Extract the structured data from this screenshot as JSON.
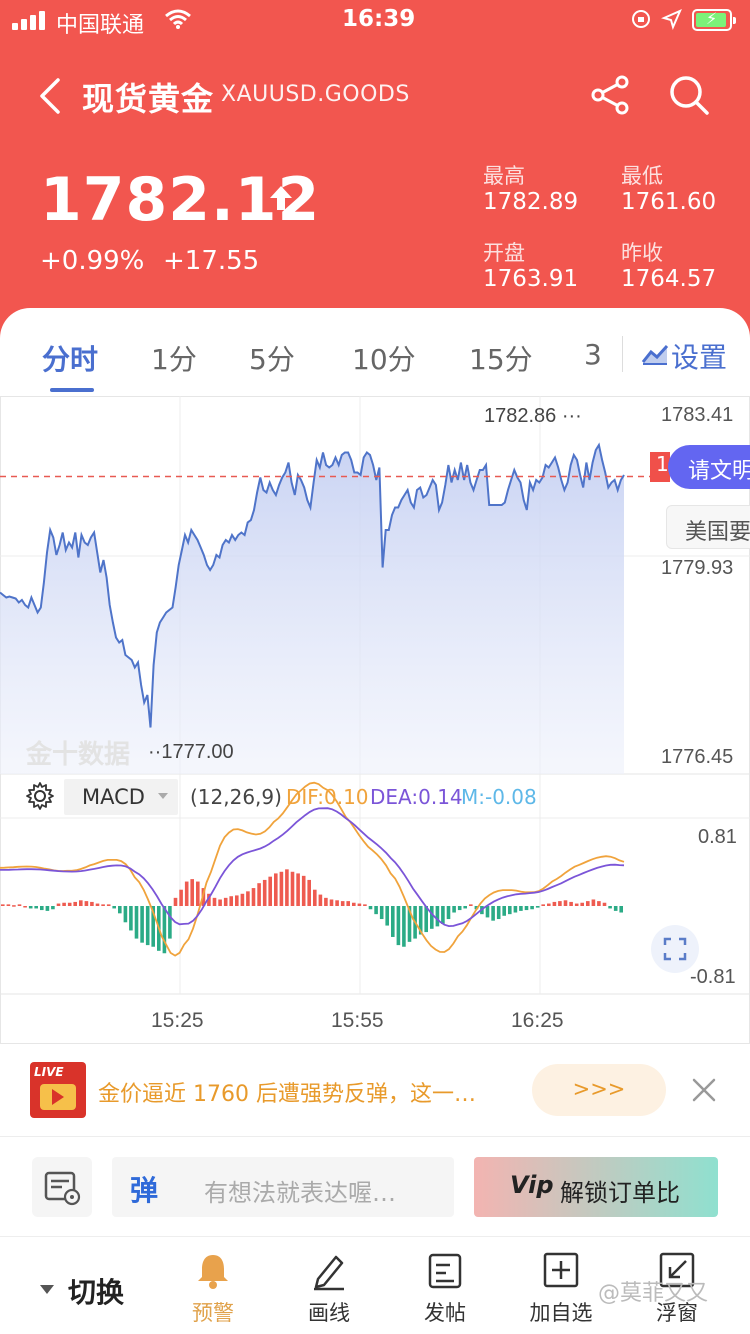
{
  "status_bar": {
    "carrier": "中国联通",
    "time": "16:39"
  },
  "header": {
    "title": "现货黄金",
    "symbol": "XAUUSD.GOODS"
  },
  "quote": {
    "price": "1782.12",
    "change_percent": "+0.99%",
    "change_value": "+17.55",
    "stats": [
      {
        "label": "最高",
        "value": "1782.89"
      },
      {
        "label": "最低",
        "value": "1761.60"
      },
      {
        "label": "开盘",
        "value": "1763.91"
      },
      {
        "label": "昨收",
        "value": "1764.57"
      }
    ]
  },
  "tabs": [
    {
      "label": "分时",
      "active": true
    },
    {
      "label": "1分"
    },
    {
      "label": "5分"
    },
    {
      "label": "10分"
    },
    {
      "label": "15分"
    },
    {
      "label": "3"
    }
  ],
  "settings_label": "设置",
  "chart_data": {
    "type": "area",
    "ylim": [
      1776.45,
      1783.41
    ],
    "yticks": [
      "1783.41",
      "1779.93",
      "1776.45"
    ],
    "xticks": [
      "15:25",
      "15:55",
      "16:25"
    ],
    "reference_line": 1782.12,
    "high_marker": "1782.86",
    "low_marker": "1777.00",
    "price_series": [
      1779.8,
      1779.75,
      1779.7,
      1779.72,
      1779.7,
      1779.68,
      1779.6,
      1779.65,
      1779.55,
      1779.5,
      1779.7,
      1779.55,
      1779.4,
      1779.5,
      1780.0,
      1780.6,
      1781.05,
      1780.9,
      1780.55,
      1780.75,
      1781.0,
      1780.65,
      1780.8,
      1780.7,
      1781.0,
      1780.5,
      1780.95,
      1780.8,
      1780.75,
      1780.9,
      1781.0,
      1780.6,
      1780.2,
      1780.45,
      1780.1,
      1779.55,
      1779.2,
      1778.9,
      1778.8,
      1778.85,
      1778.55,
      1778.5,
      1778.45,
      1778.3,
      1778.4,
      1777.95,
      1777.6,
      1777.75,
      1777.1,
      1778.35,
      1779.0,
      1779.2,
      1779.3,
      1779.4,
      1779.45,
      1779.5,
      1779.9,
      1780.35,
      1780.65,
      1780.95,
      1780.8,
      1781.05,
      1780.95,
      1780.85,
      1780.7,
      1780.55,
      1780.35,
      1780.25,
      1780.35,
      1780.55,
      1780.5,
      1780.75,
      1780.85,
      1780.8,
      1780.95,
      1780.85,
      1780.95,
      1781.0,
      1780.95,
      1781.2,
      1781.25,
      1781.45,
      1781.8,
      1782.1,
      1781.85,
      1781.8,
      1782.0,
      1781.85,
      1781.75,
      1781.95,
      1782.1,
      1782.2,
      1782.4,
      1782.0,
      1781.75,
      1782.15,
      1782.05,
      1781.9,
      1781.65,
      1781.5,
      1782.0,
      1782.45,
      1782.3,
      1782.6,
      1782.35,
      1782.3,
      1782.35,
      1782.5,
      1782.35,
      1782.55,
      1782.6,
      1782.6,
      1782.45,
      1782.2,
      1782.2,
      1782.15,
      1782.5,
      1782.6,
      1782.55,
      1782.35,
      1782.05,
      1782.3,
      1780.3,
      1781.05,
      1781.05,
      1781.35,
      1781.5,
      1781.5,
      1781.65,
      1781.75,
      1781.85,
      1781.6,
      1781.5,
      1781.85,
      1781.9,
      1781.7,
      1781.75,
      1781.9,
      1782.05,
      1781.95,
      1781.45,
      1781.6,
      1781.95,
      1782.35,
      1782.0,
      1782.25,
      1782.05,
      1782.4,
      1782.05,
      1782.35,
      1782.0,
      1781.85,
      1782.05,
      1782.25,
      1782.25,
      1782.35,
      1781.55,
      1781.55,
      1781.55,
      1781.55,
      1781.55,
      1781.6,
      1781.85,
      1782.05,
      1782.25,
      1782.1,
      1782.0,
      1781.65,
      1781.45,
      1782.0,
      1781.85,
      1782.05,
      1782.0,
      1782.1,
      1782.35,
      1782.3,
      1782.4,
      1782.5,
      1782.3,
      1782.05,
      1781.85,
      1782.0,
      1782.35,
      1782.55,
      1782.45,
      1782.15,
      1781.9,
      1782.4,
      1782.05,
      1782.4,
      1782.65,
      1782.75,
      1782.45,
      1782.2,
      1781.9,
      1782.0,
      1782.05,
      1781.85,
      1782.05,
      1782.15
    ],
    "macd_label": "MACD",
    "macd_params": "(12,26,9)",
    "dif": "DIF:0.10",
    "dea": "DEA:0.14",
    "m": "M:-0.08",
    "macd_ylim": [
      -0.81,
      0.81
    ],
    "macd_yticks": [
      "0.81",
      "-0.81"
    ],
    "macd_hist": [
      0.02,
      0.02,
      0.01,
      0.02,
      0.0,
      -0.03,
      -0.03,
      -0.05,
      -0.06,
      -0.04,
      0.03,
      0.04,
      0.04,
      0.05,
      0.07,
      0.06,
      0.05,
      0.03,
      0.02,
      0.02,
      -0.03,
      -0.09,
      -0.2,
      -0.3,
      -0.4,
      -0.45,
      -0.48,
      -0.5,
      -0.55,
      -0.58,
      -0.4,
      0.1,
      0.2,
      0.3,
      0.33,
      0.3,
      0.22,
      0.15,
      0.1,
      0.08,
      0.1,
      0.12,
      0.13,
      0.15,
      0.18,
      0.22,
      0.28,
      0.32,
      0.36,
      0.4,
      0.42,
      0.45,
      0.42,
      0.4,
      0.37,
      0.32,
      0.2,
      0.14,
      0.1,
      0.08,
      0.07,
      0.06,
      0.06,
      0.04,
      0.03,
      0.02,
      -0.04,
      -0.1,
      -0.16,
      -0.24,
      -0.38,
      -0.48,
      -0.5,
      -0.44,
      -0.4,
      -0.35,
      -0.32,
      -0.28,
      -0.25,
      -0.22,
      -0.16,
      -0.08,
      -0.05,
      -0.03,
      0.02,
      -0.04,
      -0.1,
      -0.14,
      -0.18,
      -0.16,
      -0.12,
      -0.1,
      -0.08,
      -0.06,
      -0.05,
      -0.04,
      -0.02,
      0.02,
      0.03,
      0.05,
      0.06,
      0.07,
      0.05,
      0.03,
      0.04,
      0.06,
      0.08,
      0.06,
      0.04,
      -0.03,
      -0.06,
      -0.08
    ]
  },
  "buttons": {
    "read_news": "请文明",
    "us_data": "美国要"
  },
  "watermark": "金十数据",
  "news_banner": {
    "live": "LIVE",
    "text": "金价逼近 1760 后遭强势反弹，这一…",
    "more": ">>>"
  },
  "comment_bar": {
    "dan_icon": "弹",
    "placeholder": "有想法就表达喔…",
    "vip": "Vip",
    "vip_text": "解锁订单比"
  },
  "bottom_nav": {
    "switch": "切换",
    "items": [
      {
        "label": "预警",
        "icon": "bell-icon",
        "active": true
      },
      {
        "label": "画线",
        "icon": "pencil-icon"
      },
      {
        "label": "发帖",
        "icon": "post-icon"
      },
      {
        "label": "加自选",
        "icon": "add-box-icon"
      },
      {
        "label": "浮窗",
        "icon": "float-window-icon"
      }
    ],
    "watermark": "@莫菲又又"
  },
  "colors": {
    "header_red": "#f2564f",
    "accent_blue": "#4a6fcf",
    "dif_orange": "#f0a33c",
    "dea_purple": "#7b55d8",
    "hist_up": "#ee5b50",
    "hist_down": "#2bab86"
  }
}
